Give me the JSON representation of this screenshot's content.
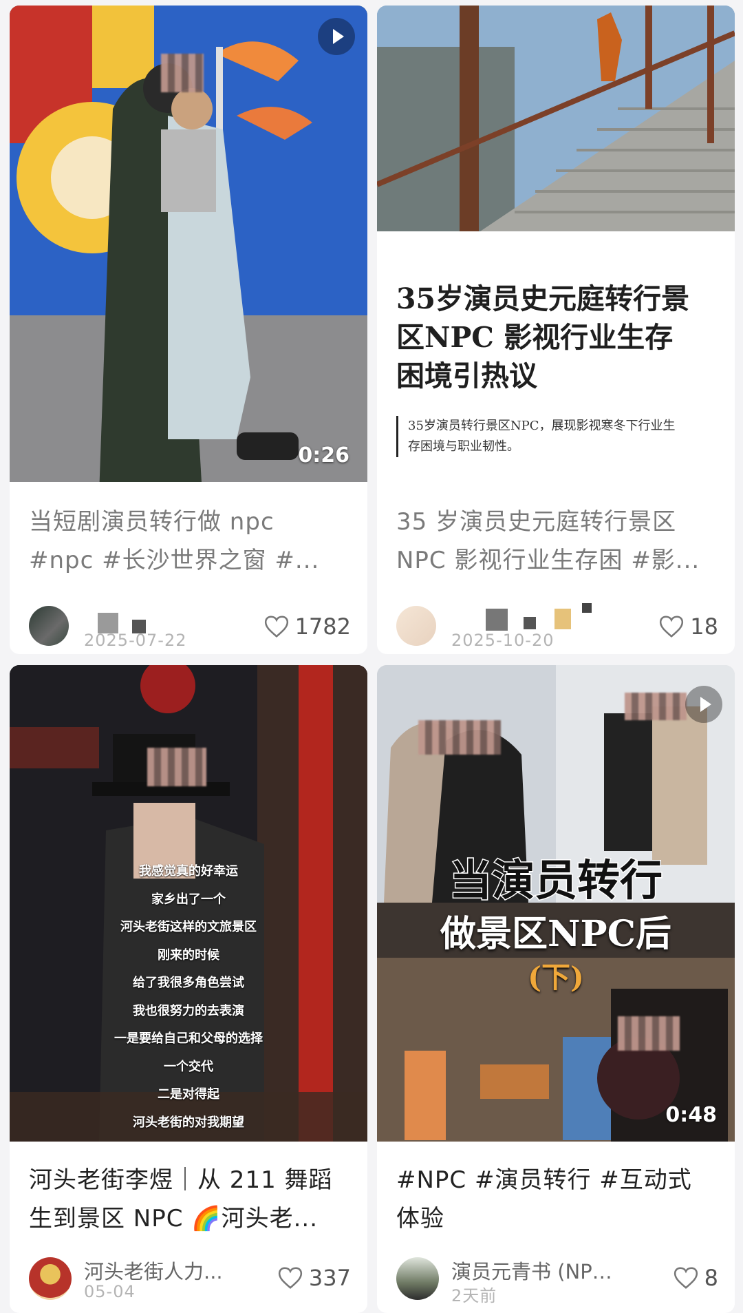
{
  "cards": [
    {
      "title_lines": [
        "当短剧演员转行做 npc",
        "#npc  #长沙世界之窗  #..."
      ],
      "author": "",
      "date": "2025-07-22",
      "likes": "1782",
      "duration": "0:26"
    },
    {
      "headline_lines": [
        "35岁演员史元庭转行景",
        "区NPC 影视行业生存",
        "困境引热议"
      ],
      "summary_lines": [
        "35岁演员转行景区NPC，展现影视寒冬下行业生",
        "存困境与职业韧性。"
      ],
      "title_lines": [
        "35 岁演员史元庭转行景区",
        "NPC 影视行业生存困 #影..."
      ],
      "author": "",
      "date": "2025-10-20",
      "likes": "18"
    },
    {
      "subtitles": [
        "我感觉真的好幸运",
        "家乡出了一个",
        "河头老街这样的文旅景区",
        "刚来的时候",
        "给了我很多角色尝试",
        "我也很努力的去表演",
        "一是要给自己和父母的选择",
        "一个交代",
        "二是对得起",
        "河头老街的对我期望"
      ],
      "title_lines": [
        "河头老街李煜｜从 211 舞蹈",
        "生到景区 NPC 🌈河头老..."
      ],
      "author": "河头老街人力...",
      "date": "05-04",
      "likes": "337"
    },
    {
      "overlay_line1": "当演员转行",
      "overlay_line2": "做景区NPC后",
      "overlay_line3": "(下)",
      "title_lines": [
        "#NPC #演员转行 #互动式",
        "体验"
      ],
      "author": "演员元青书 (NPC...",
      "date": "2天前",
      "likes": "8",
      "duration": "0:48"
    }
  ],
  "colors": {
    "background": "#f4f4f6",
    "card": "#ffffff",
    "muted_text": "#7a7a7a",
    "like_icon": "#777777"
  },
  "icons": [
    "heart-outline-icon",
    "play-icon"
  ]
}
